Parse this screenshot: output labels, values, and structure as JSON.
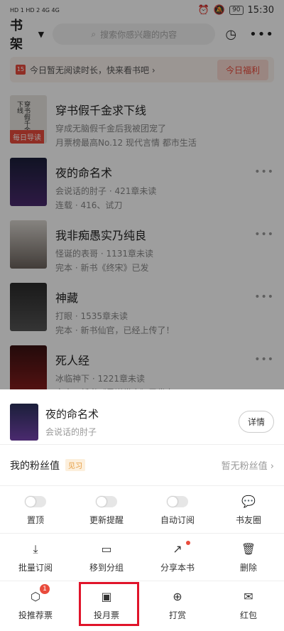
{
  "status_bar": {
    "left": "HD 1  HD 2  4G  4G",
    "battery": "90",
    "time": "15:30"
  },
  "header": {
    "title": "书架",
    "search_placeholder": "搜索你感兴趣的内容"
  },
  "banner": {
    "calendar_day": "15",
    "text": "今日暂无阅读时长，快来看书吧 ›",
    "bonus_label": "今日福利"
  },
  "books": [
    {
      "name": "穿书假千金求下线",
      "author": "穿成无脑假千金后我被团宠了",
      "status": "月票榜最高No.12  现代言情  都市生活",
      "ribbon": "每日导读"
    },
    {
      "name": "夜的命名术",
      "author": "会说话的肘子 · 421章未读",
      "status": "连载 · 416、试刀"
    },
    {
      "name": "我非痴愚实乃纯良",
      "author": "怪诞的表哥 · 1131章未读",
      "status": "完本 · 新书《终宋》已发"
    },
    {
      "name": "神藏",
      "author": "打眼 · 1535章未读",
      "status": "完本 · 新书仙官，已经上传了！"
    },
    {
      "name": "死人经",
      "author": "冰临神下 · 1221章未读",
      "status": "完本 · 新书《星谋世家》已发布"
    }
  ],
  "sheet": {
    "book_name": "夜的命名术",
    "book_author": "会说话的肘子",
    "detail_label": "详情",
    "fans_label": "我的粉丝值",
    "fans_tag": "见习",
    "fans_value": "暂无粉丝值 ›",
    "row1": [
      "置顶",
      "更新提醒",
      "自动订阅",
      "书友圈"
    ],
    "row2": [
      "批量订阅",
      "移到分组",
      "分享本书",
      "删除"
    ],
    "row3": [
      "投推荐票",
      "投月票",
      "打赏",
      "红包"
    ],
    "recommend_badge": "1"
  },
  "colors": {
    "accent": "#e94b3c",
    "highlight": "#e0142a"
  }
}
